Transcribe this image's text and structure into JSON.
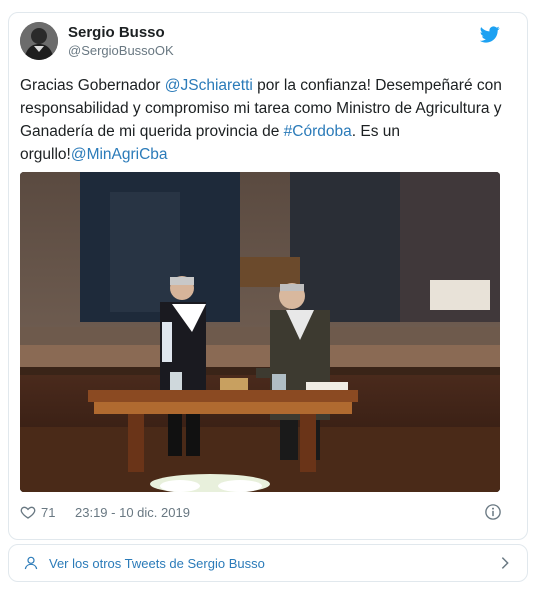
{
  "user": {
    "display_name": "Sergio Busso",
    "handle": "@SergioBussoOK",
    "avatar_icon": "avatar-photo"
  },
  "tweet": {
    "segments": [
      {
        "text": "Gracias Gobernador ",
        "link": false
      },
      {
        "text": "@JSchiaretti",
        "link": true
      },
      {
        "text": " por la confianza! Desempeñaré con responsabilidad y compromiso mi tarea como Ministro de Agricultura y Ganadería de mi querida provincia de ",
        "link": false
      },
      {
        "text": "#Córdoba",
        "link": true
      },
      {
        "text": ". Es un orgullo!",
        "link": false
      },
      {
        "text": "@MinAgriCba",
        "link": true
      }
    ]
  },
  "meta": {
    "likes": "71",
    "timestamp": "23:19 - 10 dic. 2019"
  },
  "footer": {
    "more_tweets_label": "Ver los otros Tweets de Sergio Busso"
  },
  "colors": {
    "link": "#2b7bb9",
    "twitter_blue": "#1da1f2",
    "muted": "#697882",
    "border": "#e1e8ed"
  },
  "icons": [
    "twitter-bird-icon",
    "heart-icon",
    "info-icon",
    "person-icon",
    "chevron-right-icon"
  ]
}
